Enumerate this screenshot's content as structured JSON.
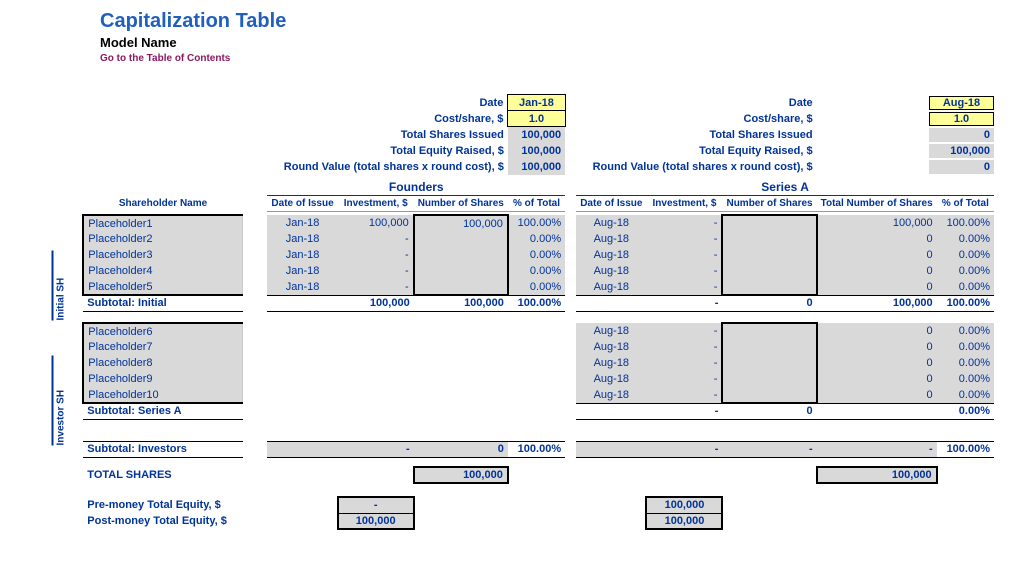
{
  "header": {
    "title": "Capitalization Table",
    "model_name": "Model Name",
    "toc_link": "Go to the Table of Contents"
  },
  "labels": {
    "date": "Date",
    "cost_share": "Cost/share, $",
    "total_shares_issued": "Total Shares Issued",
    "total_equity_raised": "Total Equity Raised, $",
    "round_value": "Round Value (total shares x round cost), $",
    "shareholder_name": "Shareholder Name",
    "date_of_issue": "Date of Issue",
    "investment": "Investment, $",
    "number_of_shares": "Number of Shares",
    "total_number_of_shares": "Total Number of Shares",
    "pct_of_total": "% of Total",
    "founders": "Founders",
    "series_a": "Series A",
    "subtotal_initial": "Subtotal: Initial",
    "subtotal_series_a": "Subtotal: Series A",
    "subtotal_investors": "Subtotal: Investors",
    "total_shares": "TOTAL SHARES",
    "premoney": "Pre-money Total Equity, $",
    "postmoney": "Post-money Total Equity, $"
  },
  "founders": {
    "date": "Jan-18",
    "cost_share": "1.0",
    "total_shares_issued": "100,000",
    "total_equity_raised": "100,000",
    "round_value": "100,000"
  },
  "seriesA": {
    "date": "Aug-18",
    "cost_share": "1.0",
    "total_shares_issued": "0",
    "total_equity_raised": "100,000",
    "round_value": "0"
  },
  "initial_rows": [
    {
      "name": "Placeholder1",
      "f_date": "Jan-18",
      "f_inv": "100,000",
      "f_shares": "100,000",
      "f_pct": "100.00%",
      "a_date": "Aug-18",
      "a_inv": "-",
      "a_shares": "",
      "a_total": "100,000",
      "a_pct": "100.00%"
    },
    {
      "name": "Placeholder2",
      "f_date": "Jan-18",
      "f_inv": "-",
      "f_shares": "",
      "f_pct": "0.00%",
      "a_date": "Aug-18",
      "a_inv": "-",
      "a_shares": "",
      "a_total": "0",
      "a_pct": "0.00%"
    },
    {
      "name": "Placeholder3",
      "f_date": "Jan-18",
      "f_inv": "-",
      "f_shares": "",
      "f_pct": "0.00%",
      "a_date": "Aug-18",
      "a_inv": "-",
      "a_shares": "",
      "a_total": "0",
      "a_pct": "0.00%"
    },
    {
      "name": "Placeholder4",
      "f_date": "Jan-18",
      "f_inv": "-",
      "f_shares": "",
      "f_pct": "0.00%",
      "a_date": "Aug-18",
      "a_inv": "-",
      "a_shares": "",
      "a_total": "0",
      "a_pct": "0.00%"
    },
    {
      "name": "Placeholder5",
      "f_date": "Jan-18",
      "f_inv": "-",
      "f_shares": "",
      "f_pct": "0.00%",
      "a_date": "Aug-18",
      "a_inv": "-",
      "a_shares": "",
      "a_total": "0",
      "a_pct": "0.00%"
    }
  ],
  "subtotal_initial": {
    "f_inv": "100,000",
    "f_shares": "100,000",
    "f_pct": "100.00%",
    "a_inv": "-",
    "a_shares": "0",
    "a_total": "100,000",
    "a_pct": "100.00%"
  },
  "investor_rows": [
    {
      "name": "Placeholder6",
      "a_date": "Aug-18",
      "a_inv": "-",
      "a_shares": "",
      "a_total": "0",
      "a_pct": "0.00%"
    },
    {
      "name": "Placeholder7",
      "a_date": "Aug-18",
      "a_inv": "-",
      "a_shares": "",
      "a_total": "0",
      "a_pct": "0.00%"
    },
    {
      "name": "Placeholder8",
      "a_date": "Aug-18",
      "a_inv": "-",
      "a_shares": "",
      "a_total": "0",
      "a_pct": "0.00%"
    },
    {
      "name": "Placeholder9",
      "a_date": "Aug-18",
      "a_inv": "-",
      "a_shares": "",
      "a_total": "0",
      "a_pct": "0.00%"
    },
    {
      "name": "Placeholder10",
      "a_date": "Aug-18",
      "a_inv": "-",
      "a_shares": "",
      "a_total": "0",
      "a_pct": "0.00%"
    }
  ],
  "subtotal_series_a": {
    "a_inv": "-",
    "a_shares": "0",
    "a_total": "",
    "a_pct": "0.00%"
  },
  "subtotal_investors": {
    "f_inv": "-",
    "f_shares": "0",
    "f_pct": "100.00%",
    "a_inv": "-",
    "a_shares": "-",
    "a_total": "-",
    "a_pct": "100.00%"
  },
  "totals": {
    "founders_shares": "100,000",
    "seriesA_shares": "100,000",
    "premoney_f": "-",
    "postmoney_f": "100,000",
    "premoney_a": "100,000",
    "postmoney_a": "100,000"
  }
}
